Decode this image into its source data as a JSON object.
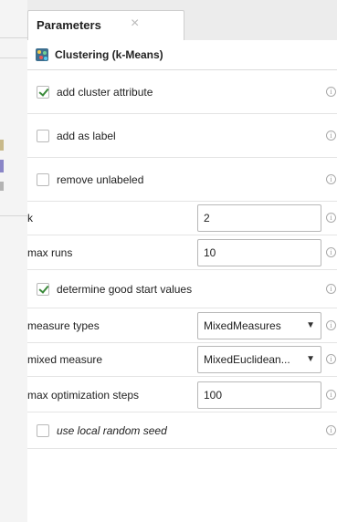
{
  "tab": {
    "label": "Parameters",
    "close_glyph": "×"
  },
  "operator": {
    "title": "Clustering (k-Means)",
    "icon": "clustering-icon"
  },
  "info_icon": "info-icon",
  "info_glyph": "i",
  "params": {
    "add_cluster_attribute": {
      "label": "add cluster attribute",
      "checked": true
    },
    "add_as_label": {
      "label": "add as label",
      "checked": false
    },
    "remove_unlabeled": {
      "label": "remove unlabeled",
      "checked": false
    },
    "k": {
      "label": "k",
      "value": "2"
    },
    "max_runs": {
      "label": "max runs",
      "value": "10"
    },
    "determine_good_start_values": {
      "label": "determine good start values",
      "checked": true
    },
    "measure_types": {
      "label": "measure types",
      "value": "MixedMeasures"
    },
    "mixed_measure": {
      "label": "mixed measure",
      "value": "MixedEuclidean..."
    },
    "max_optimization_steps": {
      "label": "max optimization steps",
      "value": "100"
    },
    "use_local_random_seed": {
      "label": "use local random seed",
      "checked": false
    }
  },
  "caret_glyph": "▼"
}
